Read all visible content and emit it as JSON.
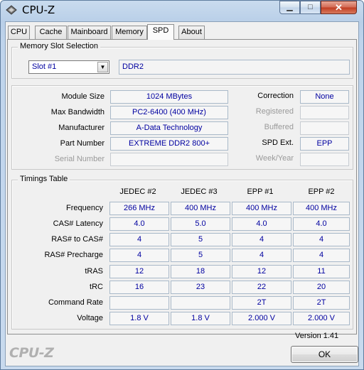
{
  "window": {
    "title": "CPU-Z",
    "minimize_label": "▁",
    "maximize_label": "□",
    "close_label": "✕"
  },
  "tabs": [
    {
      "label": "CPU"
    },
    {
      "label": "Cache"
    },
    {
      "label": "Mainboard"
    },
    {
      "label": "Memory"
    },
    {
      "label": "SPD"
    },
    {
      "label": "About"
    }
  ],
  "active_tab": "SPD",
  "slot_selection": {
    "title": "Memory Slot Selection",
    "selected_slot": "Slot #1",
    "memory_type": "DDR2"
  },
  "module_info": {
    "module_size_label": "Module Size",
    "module_size": "1024 MBytes",
    "max_bandwidth_label": "Max Bandwidth",
    "max_bandwidth": "PC2-6400 (400 MHz)",
    "manufacturer_label": "Manufacturer",
    "manufacturer": "A-Data Technology",
    "part_number_label": "Part Number",
    "part_number": "EXTREME DDR2 800+",
    "serial_number_label": "Serial Number",
    "serial_number": "",
    "correction_label": "Correction",
    "correction": "None",
    "registered_label": "Registered",
    "registered": "",
    "buffered_label": "Buffered",
    "buffered": "",
    "spd_ext_label": "SPD Ext.",
    "spd_ext": "EPP",
    "week_year_label": "Week/Year",
    "week_year": ""
  },
  "timings": {
    "title": "Timings Table",
    "columns": [
      "JEDEC #2",
      "JEDEC #3",
      "EPP #1",
      "EPP #2"
    ],
    "rows": [
      {
        "label": "Frequency",
        "values": [
          "266 MHz",
          "400 MHz",
          "400 MHz",
          "400 MHz"
        ]
      },
      {
        "label": "CAS# Latency",
        "values": [
          "4.0",
          "5.0",
          "4.0",
          "4.0"
        ]
      },
      {
        "label": "RAS# to CAS#",
        "values": [
          "4",
          "5",
          "4",
          "4"
        ]
      },
      {
        "label": "RAS# Precharge",
        "values": [
          "4",
          "5",
          "4",
          "4"
        ]
      },
      {
        "label": "tRAS",
        "values": [
          "12",
          "18",
          "12",
          "11"
        ]
      },
      {
        "label": "tRC",
        "values": [
          "16",
          "23",
          "22",
          "20"
        ]
      },
      {
        "label": "Command Rate",
        "values": [
          "",
          "",
          "2T",
          "2T"
        ]
      },
      {
        "label": "Voltage",
        "values": [
          "1.8 V",
          "1.8 V",
          "2.000 V",
          "2.000 V"
        ]
      }
    ]
  },
  "footer": {
    "version": "Version 1.41",
    "brand": "CPU-Z",
    "ok_label": "OK"
  },
  "colors": {
    "value_text": "#0000a0",
    "title_bar": "#c9dbee",
    "close_button": "#c03d22"
  }
}
